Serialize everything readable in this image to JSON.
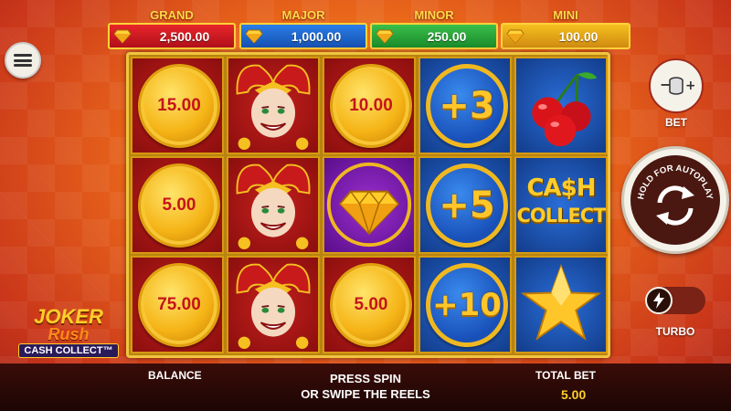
{
  "jackpots": [
    {
      "name": "GRAND",
      "value": "2,500.00",
      "color": "#e8262a"
    },
    {
      "name": "MAJOR",
      "value": "1,000.00",
      "color": "#2a7ee8"
    },
    {
      "name": "MINOR",
      "value": "250.00",
      "color": "#3ac04a"
    },
    {
      "name": "MINI",
      "value": "100.00",
      "color": "#f5c020"
    }
  ],
  "reels": {
    "coins": {
      "r1c1": "15.00",
      "r1c2": "5.00",
      "r1c3": "75.00",
      "r3c1": "10.00",
      "r3c3": "5.00",
      "r4c1": "+3",
      "r4c2": "+5",
      "r4c3": "+10"
    },
    "cash_collect_line1": "CA$H",
    "cash_collect_line2": "COLLECT",
    "symbols": [
      "jester",
      "jester",
      "jester",
      "diamond",
      "cherries",
      "cash-collect",
      "star"
    ]
  },
  "controls": {
    "bet_label": "BET",
    "spin_hint": "HOLD FOR AUTOPLAY",
    "turbo_label": "TURBO"
  },
  "logo": {
    "line1": "JOKER",
    "line2": "Rush",
    "line3": "CASH COLLECT™"
  },
  "bottom_bar": {
    "balance_label": "BALANCE",
    "message_line1": "PRESS SPIN",
    "message_line2": "OR SWIPE THE REELS",
    "total_bet_label": "TOTAL BET",
    "total_bet_value": "5.00"
  },
  "colors": {
    "accent_gold": "#ffcf2a",
    "coin_text_red": "#c4151a",
    "bottom_bar": "#2a0a06"
  }
}
